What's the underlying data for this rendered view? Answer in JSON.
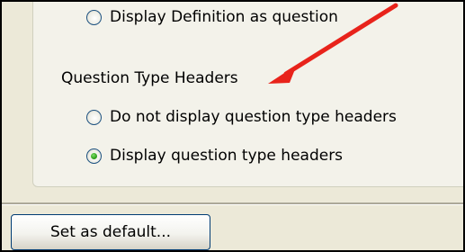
{
  "options": {
    "definition_radio": {
      "label": "Display Definition as question",
      "selected": false
    },
    "section_title": "Question Type Headers",
    "header_options": [
      {
        "label": "Do not display question type headers",
        "selected": false
      },
      {
        "label": "Display question type headers",
        "selected": true
      }
    ]
  },
  "footer": {
    "default_button_label": "Set as default..."
  },
  "annotation": {
    "arrow_color": "#e8231b"
  }
}
